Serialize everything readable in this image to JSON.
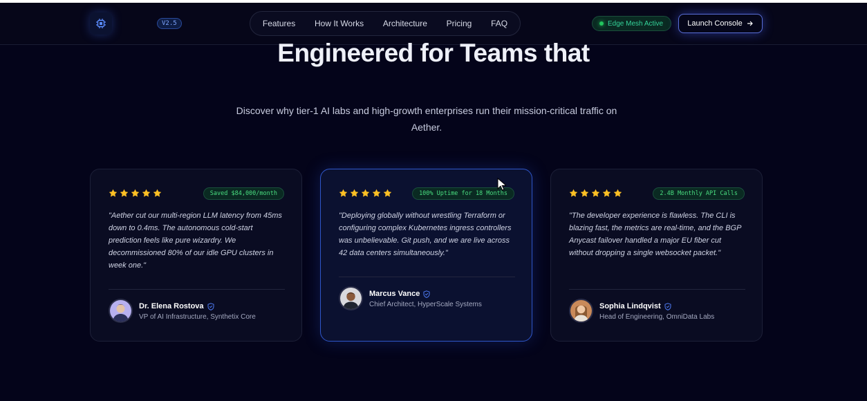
{
  "nav": {
    "logo_icon": "chip-icon",
    "version": "V2.5",
    "links": [
      "Features",
      "How It Works",
      "Architecture",
      "Pricing",
      "FAQ"
    ],
    "status": "Edge Mesh Active",
    "cta": "Launch Console"
  },
  "hero": {
    "title": "Engineered for Teams that",
    "subtitle": "Discover why tier-1 AI labs and high-growth enterprises run their mission-critical traffic on Aether."
  },
  "testimonials": [
    {
      "rating": 5,
      "metric": "Saved $84,000/month",
      "quote": "\"Aether cut our multi-region LLM latency from 45ms down to 0.4ms. The autonomous cold-start prediction feels like pure wizardry. We decommissioned 80% of our idle GPU clusters in week one.\"",
      "name": "Dr. Elena Rostova",
      "role": "VP of AI Infrastructure, Synthetix Core"
    },
    {
      "rating": 5,
      "metric": "100% Uptime for 18 Months",
      "quote": "\"Deploying globally without wrestling Terraform or configuring complex Kubernetes ingress controllers was unbelievable. Git push, and we are live across 42 data centers simultaneously.\"",
      "name": "Marcus Vance",
      "role": "Chief Architect, HyperScale Systems"
    },
    {
      "rating": 5,
      "metric": "2.4B Monthly API Calls",
      "quote": "\"The developer experience is flawless. The CLI is blazing fast, the metrics are real-time, and the BGP Anycast failover handled a major EU fiber cut without dropping a single websocket packet.\"",
      "name": "Sophia Lindqvist",
      "role": "Head of Engineering, OmniData Labs"
    }
  ],
  "colors": {
    "background": "#04041a",
    "accent": "#3b6ef6",
    "success": "#34d399",
    "star": "#fbbf24"
  }
}
